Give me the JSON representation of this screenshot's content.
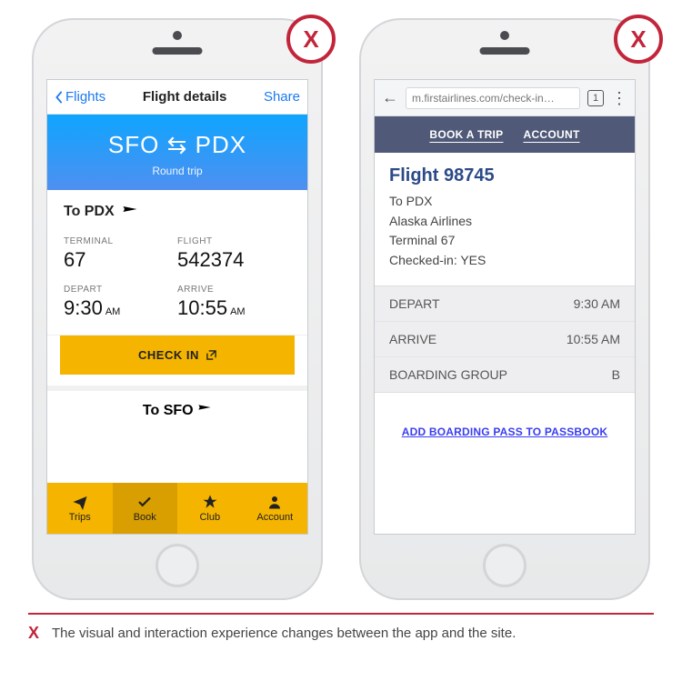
{
  "badge": "X",
  "app": {
    "nav": {
      "back": "Flights",
      "title": "Flight details",
      "share": "Share"
    },
    "hero": {
      "route": "SFO ⇆ PDX",
      "subtitle": "Round trip"
    },
    "outbound": {
      "dest_label": "To PDX",
      "terminal_label": "TERMINAL",
      "terminal_value": "67",
      "flight_label": "FLIGHT",
      "flight_value": "542374",
      "depart_label": "DEPART",
      "depart_value": "9:30",
      "depart_ampm": "AM",
      "arrive_label": "ARRIVE",
      "arrive_value": "10:55",
      "arrive_ampm": "AM"
    },
    "checkin_label": "CHECK IN",
    "return_preview": "To SFO",
    "tabs": [
      {
        "icon": "plane",
        "label": "Trips"
      },
      {
        "icon": "check",
        "label": "Book",
        "active": true
      },
      {
        "icon": "star",
        "label": "Club"
      },
      {
        "icon": "person",
        "label": "Account"
      }
    ]
  },
  "site": {
    "url": "m.firstairlines.com/check-in…",
    "tab_count": "1",
    "nav": {
      "book": "BOOK A TRIP",
      "account": "ACCOUNT"
    },
    "title": "Flight 98745",
    "details": {
      "line1": "To PDX",
      "line2": "Alaska Airlines",
      "line3": "Terminal 67",
      "line4": "Checked-in: YES"
    },
    "rows": [
      {
        "label": "DEPART",
        "value": "9:30 AM"
      },
      {
        "label": "ARRIVE",
        "value": "10:55 AM"
      },
      {
        "label": "BOARDING GROUP",
        "value": "B"
      }
    ],
    "passbook": "ADD BOARDING PASS TO PASSBOOK"
  },
  "caption": {
    "marker": "X",
    "text": "The visual and interaction experience changes between the app and the site."
  }
}
